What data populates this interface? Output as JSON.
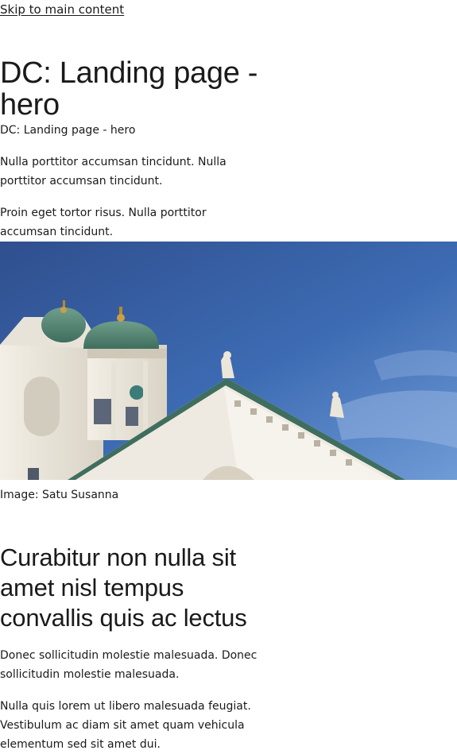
{
  "skip_link": "Skip to main content",
  "hero": {
    "title": "DC: Landing page - hero",
    "subtitle": "DC: Landing page - hero",
    "paragraphs": [
      "Nulla porttitor accumsan tincidunt. Nulla porttitor accumsan tincidunt.",
      "Proin eget tortor risus. Nulla porttitor accumsan tincidunt."
    ],
    "image_caption": "Image: Satu Susanna"
  },
  "section": {
    "title": "Curabitur non nulla sit amet nisl tempus convallis quis ac lectus",
    "paragraphs": [
      "Donec sollicitudin molestie malesuada. Donec sollicitudin molestie malesuada.",
      "Nulla quis lorem ut libero malesuada feugiat. Vestibulum ac diam sit amet quam vehicula elementum sed sit amet dui."
    ]
  }
}
